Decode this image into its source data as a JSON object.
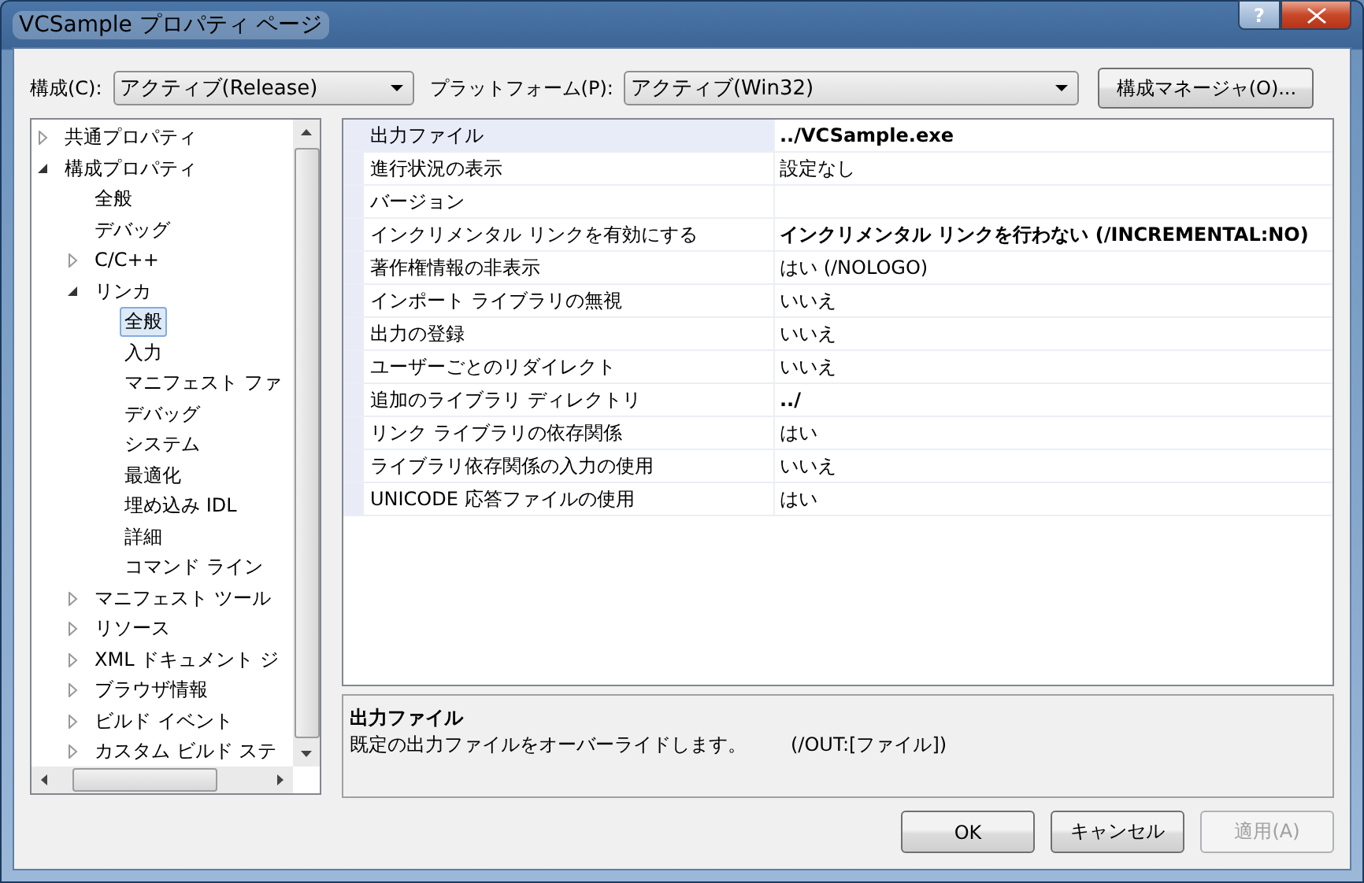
{
  "window": {
    "title": "VCSample プロパティ ページ",
    "help": "?"
  },
  "config": {
    "label": "構成(C):",
    "value": "アクティブ(Release)"
  },
  "platform": {
    "label": "プラットフォーム(P):",
    "value": "アクティブ(Win32)"
  },
  "manager_button": "構成マネージャ(O)...",
  "tree": [
    {
      "label": "共通プロパティ",
      "expanded": false,
      "selected": false
    },
    {
      "label": "構成プロパティ",
      "expanded": true,
      "selected": false,
      "children": [
        {
          "label": "全般",
          "selected": false
        },
        {
          "label": "デバッグ",
          "selected": false
        },
        {
          "label": "C/C++",
          "expanded": false,
          "selected": false
        },
        {
          "label": "リンカ",
          "expanded": true,
          "selected": false,
          "children": [
            {
              "label": "全般",
              "selected": true
            },
            {
              "label": "入力",
              "selected": false
            },
            {
              "label": "マニフェスト ファ",
              "selected": false
            },
            {
              "label": "デバッグ",
              "selected": false
            },
            {
              "label": "システム",
              "selected": false
            },
            {
              "label": "最適化",
              "selected": false
            },
            {
              "label": "埋め込み IDL",
              "selected": false
            },
            {
              "label": "詳細",
              "selected": false
            },
            {
              "label": "コマンド ライン",
              "selected": false
            }
          ]
        },
        {
          "label": "マニフェスト ツール",
          "expanded": false,
          "selected": false
        },
        {
          "label": "リソース",
          "expanded": false,
          "selected": false
        },
        {
          "label": "XML ドキュメント ジ",
          "expanded": false,
          "selected": false
        },
        {
          "label": "ブラウザ情報",
          "expanded": false,
          "selected": false
        },
        {
          "label": "ビルド イベント",
          "expanded": false,
          "selected": false
        },
        {
          "label": "カスタム ビルド ステ",
          "expanded": false,
          "selected": false
        }
      ]
    }
  ],
  "properties": [
    {
      "name": "出力ファイル",
      "value": "../VCSample.exe",
      "modified": true,
      "selected": true
    },
    {
      "name": "進行状況の表示",
      "value": "設定なし",
      "modified": false,
      "selected": false
    },
    {
      "name": "バージョン",
      "selected": false
    },
    {
      "name": "インクリメンタル リンクを有効にする",
      "value": "インクリメンタル リンクを行わない (/INCREMENTAL:NO)",
      "modified": true,
      "selected": false
    },
    {
      "name": "著作権情報の非表示",
      "value": "はい (/NOLOGO)",
      "modified": false,
      "selected": false
    },
    {
      "name": "インポート ライブラリの無視",
      "value": "いいえ",
      "modified": false,
      "selected": false
    },
    {
      "name": "出力の登録",
      "value": "いいえ",
      "modified": false,
      "selected": false
    },
    {
      "name": "ユーザーごとのリダイレクト",
      "value": "いいえ",
      "modified": false,
      "selected": false
    },
    {
      "name": "追加のライブラリ ディレクトリ",
      "value": "../",
      "modified": true,
      "selected": false
    },
    {
      "name": "リンク ライブラリの依存関係",
      "value": "はい",
      "modified": false,
      "selected": false
    },
    {
      "name": "ライブラリ依存関係の入力の使用",
      "value": "いいえ",
      "modified": false,
      "selected": false
    },
    {
      "name": "UNICODE 応答ファイルの使用",
      "value": "はい",
      "modified": false,
      "selected": false
    }
  ],
  "description": {
    "title": "出力ファイル",
    "text": "既定の出力ファイルをオーバーライドします。",
    "switch": "(/OUT:[ファイル])"
  },
  "buttons": [
    {
      "label": "OK",
      "disabled": false
    },
    {
      "label": "キャンセル",
      "disabled": false
    },
    {
      "label": "適用(A)",
      "disabled": true
    }
  ]
}
